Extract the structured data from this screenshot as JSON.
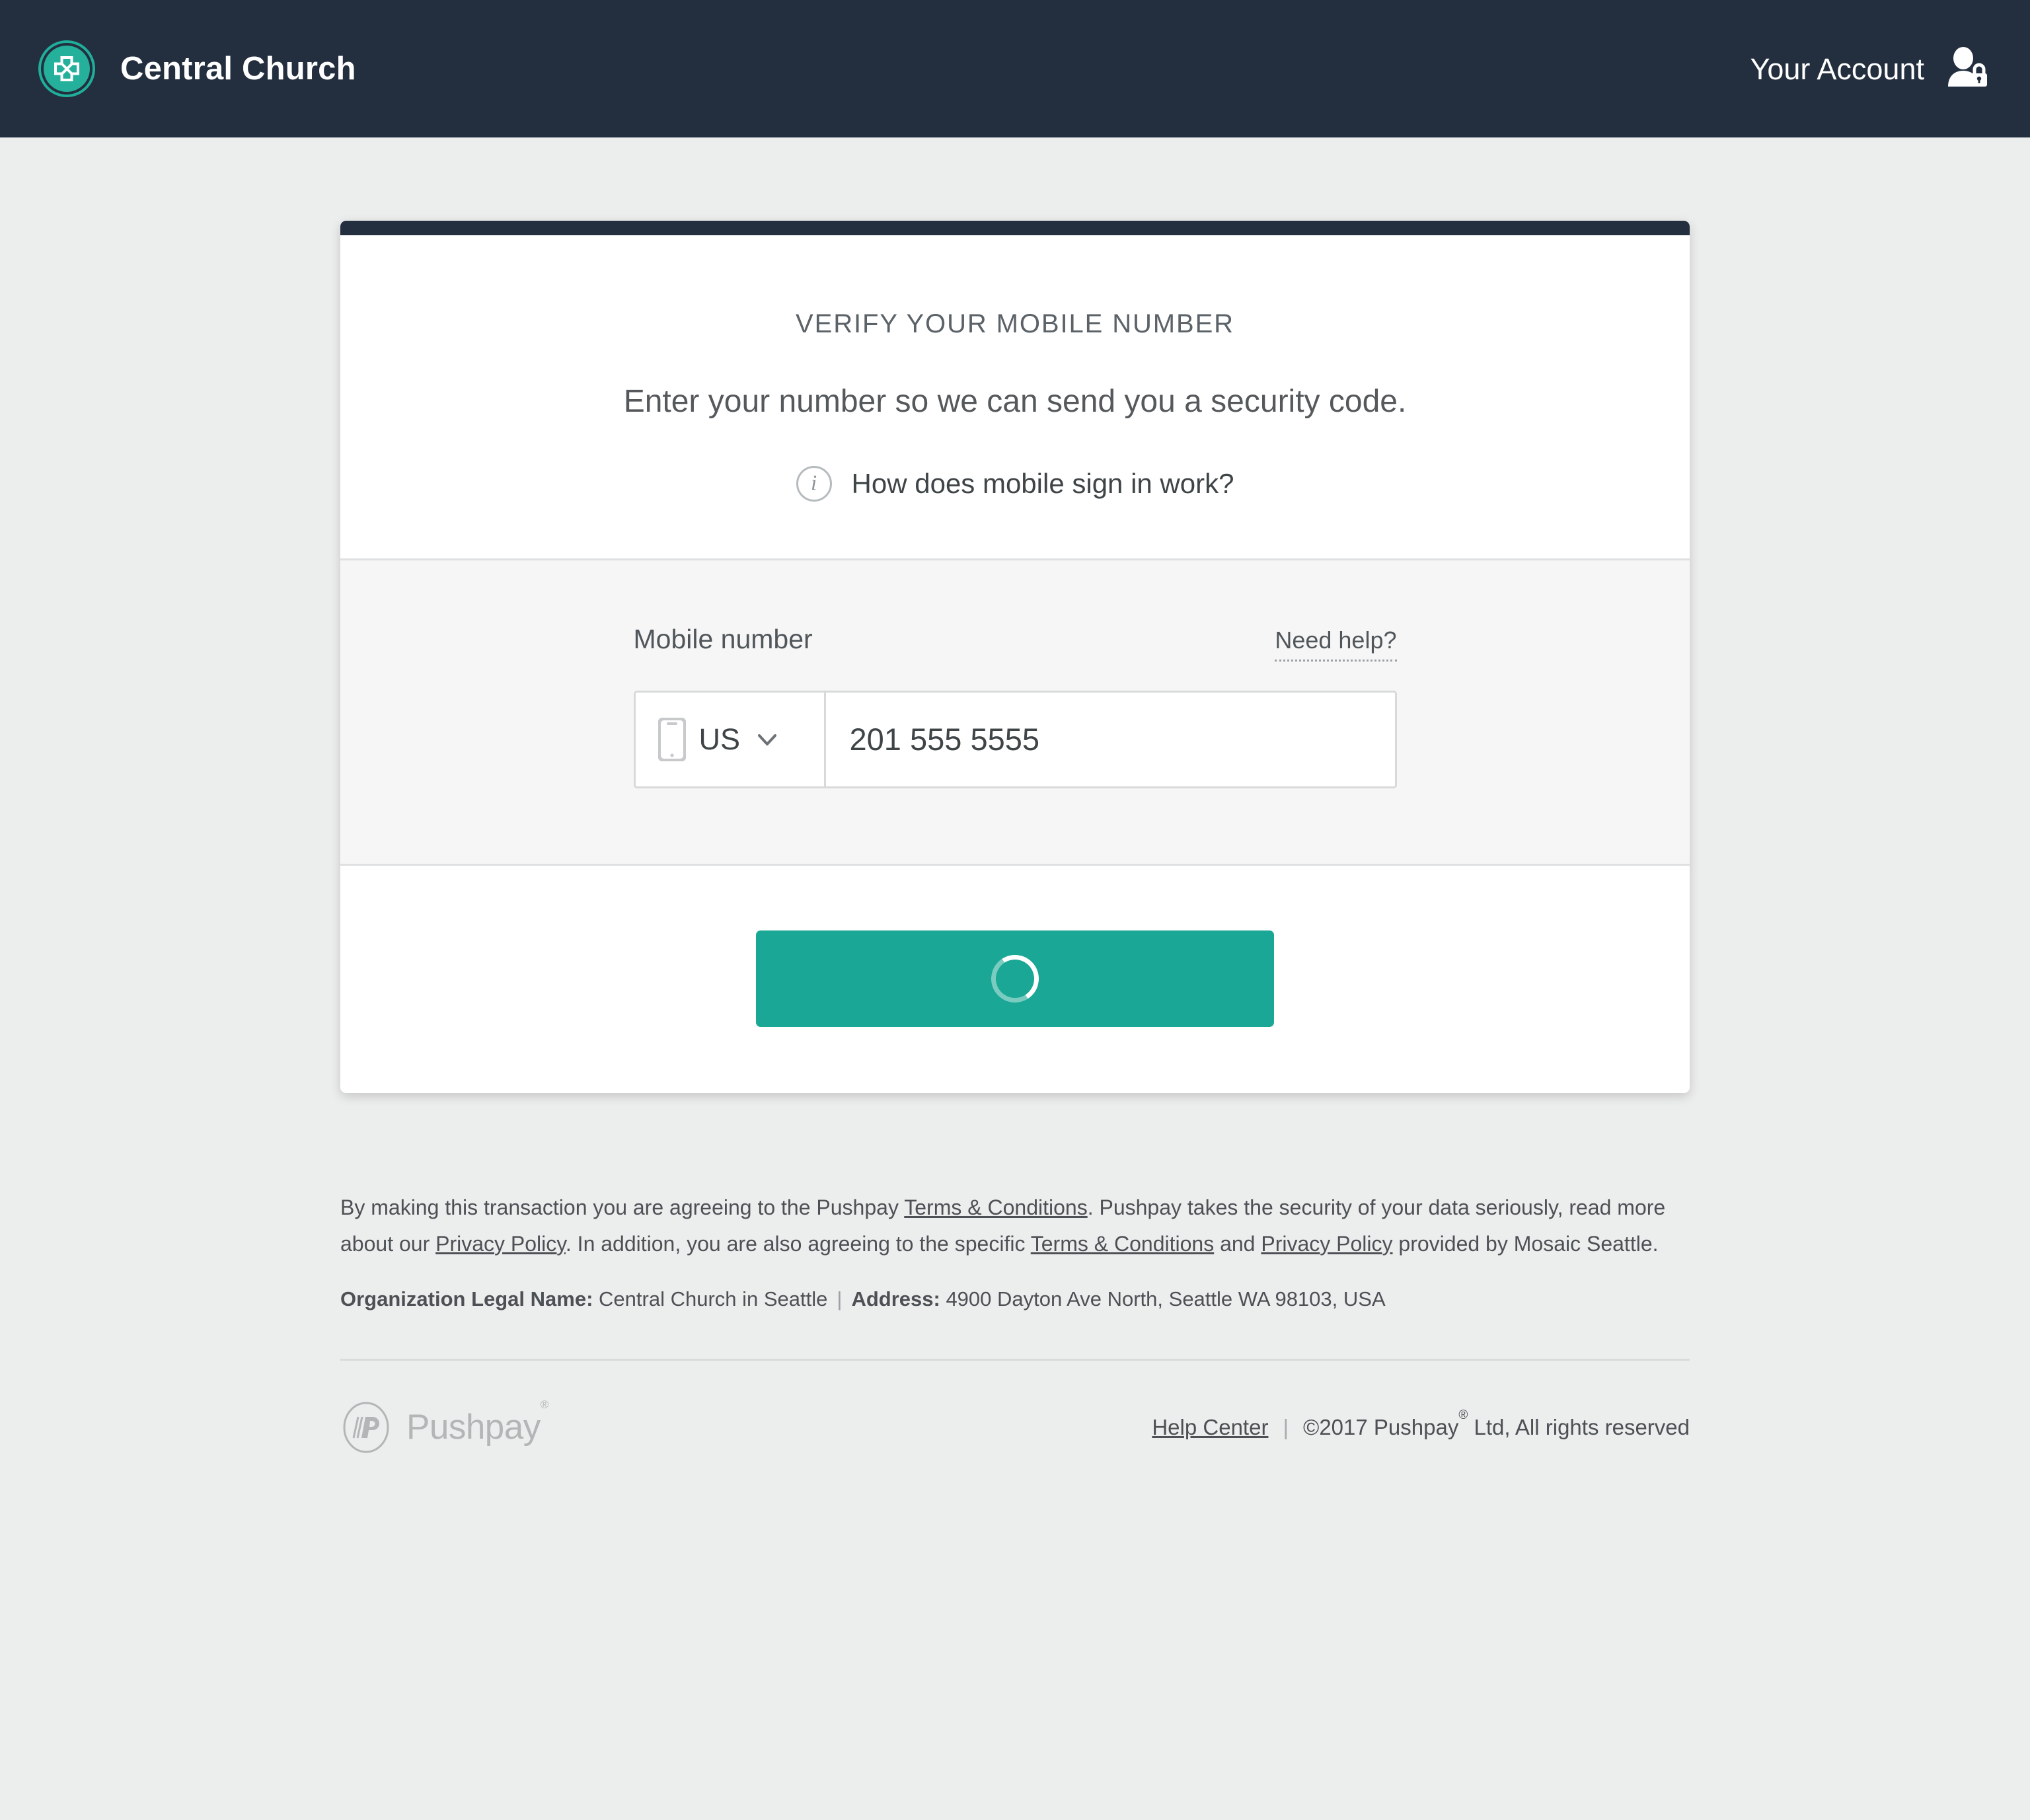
{
  "header": {
    "org_name": "Central Church",
    "logo_icon": "church-cross-logo-icon",
    "account_label": "Your Account",
    "account_icon": "user-lock-icon",
    "background_color": "#232f3e",
    "accent_color": "#1ba795"
  },
  "card": {
    "title": "VERIFY YOUR MOBILE NUMBER",
    "subtitle": "Enter your number so we can send you a security code.",
    "info_icon": "info-circle-icon",
    "how_it_works_link": "How does mobile sign in work?",
    "form": {
      "mobile_label": "Mobile number",
      "need_help_label": "Need help?",
      "phone_icon": "mobile-phone-icon",
      "country_code": "US",
      "chevron_icon": "chevron-down-icon",
      "phone_value": "201 555 5555",
      "phone_placeholder": "201 555 5555"
    },
    "submit": {
      "state": "loading",
      "spinner_icon": "loading-spinner-icon",
      "label": "",
      "color": "#1ba795"
    }
  },
  "legal": {
    "p1_a": "By making this transaction you are agreeing to the Pushpay ",
    "p1_link1": "Terms & Conditions",
    "p1_b": ". Pushpay takes the security of your data seriously, read more about our ",
    "p1_link2": "Privacy Policy",
    "p1_c": ". In addition, you are also agreeing to the specific ",
    "p1_link3": "Terms & Conditions",
    "p1_d": " and ",
    "p1_link4": "Privacy Policy",
    "p1_e": " provided by Mosaic Seattle.",
    "org_label": "Organization Legal Name:",
    "org_value": "Central Church in Seattle",
    "separator": "|",
    "address_label": "Address:",
    "address_value": "4900 Dayton Ave North, Seattle WA 98103, USA"
  },
  "footer": {
    "brand_mark_icon": "pushpay-logo-icon",
    "brand_word": "Pushpay",
    "brand_reg": "®",
    "help_center": "Help Center",
    "separator": "|",
    "copyright_a": "©2017 Pushpay",
    "copyright_reg": "®",
    "copyright_b": " Ltd, All rights reserved"
  }
}
